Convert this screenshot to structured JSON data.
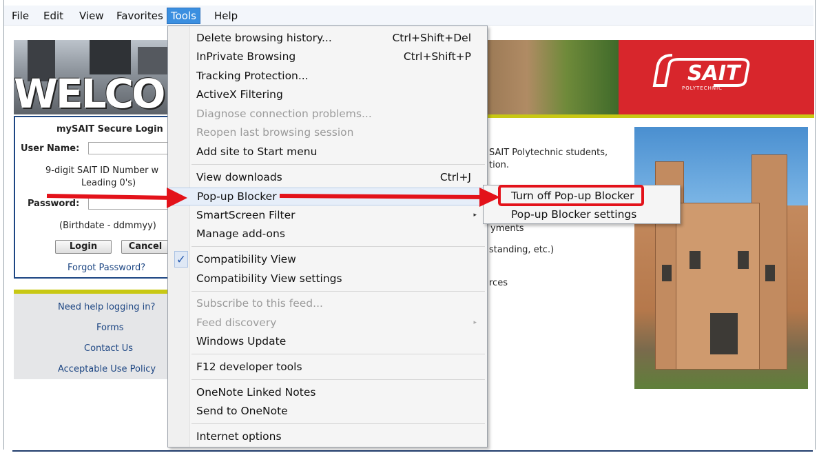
{
  "menubar": {
    "items": [
      "File",
      "Edit",
      "View",
      "Favorites",
      "Tools",
      "Help"
    ]
  },
  "banner": {
    "welcome_text": "WELCO",
    "logo_text": "SAIT",
    "logo_sub": "POLYTECHNIC",
    "accent_color": "#d8262c",
    "rule_color": "#c8c814"
  },
  "login": {
    "title": "mySAIT Secure Login",
    "username_label": "User Name:",
    "username_help_1": "9-digit SAIT ID Number w",
    "username_help_2": "Leading 0's)",
    "password_label": "Password:",
    "password_help": "(Birthdate - ddmmyy)",
    "login_button": "Login",
    "cancel_button": "Cancel",
    "forgot_link": "Forgot Password?"
  },
  "help_links": [
    "Need help logging in?",
    "Forms",
    "Contact Us",
    "Acceptable Use Policy"
  ],
  "content": {
    "line1": "SAIT Polytechnic students,",
    "line2": "tion.",
    "line3": "yments",
    "line4": "standing, etc.)",
    "line5": "rces"
  },
  "tools_menu": {
    "items": [
      {
        "label": "Delete browsing history...",
        "shortcut": "Ctrl+Shift+Del",
        "disabled": false
      },
      {
        "label": "InPrivate Browsing",
        "shortcut": "Ctrl+Shift+P",
        "disabled": false
      },
      {
        "label": "Tracking Protection...",
        "shortcut": "",
        "disabled": false
      },
      {
        "label": "ActiveX Filtering",
        "shortcut": "",
        "disabled": false
      },
      {
        "label": "Diagnose connection problems...",
        "shortcut": "",
        "disabled": true
      },
      {
        "label": "Reopen last browsing session",
        "shortcut": "",
        "disabled": true
      },
      {
        "label": "Add site to Start menu",
        "shortcut": "",
        "disabled": false
      },
      {
        "label": "View downloads",
        "shortcut": "Ctrl+J",
        "disabled": false
      },
      {
        "label": "Pop-up Blocker",
        "shortcut": "",
        "disabled": false
      },
      {
        "label": "SmartScreen Filter",
        "shortcut": "",
        "disabled": false
      },
      {
        "label": "Manage add-ons",
        "shortcut": "",
        "disabled": false
      },
      {
        "label": "Compatibility View",
        "shortcut": "",
        "disabled": false,
        "checked": true
      },
      {
        "label": "Compatibility View settings",
        "shortcut": "",
        "disabled": false
      },
      {
        "label": "Subscribe to this feed...",
        "shortcut": "",
        "disabled": true
      },
      {
        "label": "Feed discovery",
        "shortcut": "",
        "disabled": true
      },
      {
        "label": "Windows Update",
        "shortcut": "",
        "disabled": false
      },
      {
        "label": "F12 developer tools",
        "shortcut": "",
        "disabled": false
      },
      {
        "label": "OneNote Linked Notes",
        "shortcut": "",
        "disabled": false
      },
      {
        "label": "Send to OneNote",
        "shortcut": "",
        "disabled": false
      },
      {
        "label": "Internet options",
        "shortcut": "",
        "disabled": false
      }
    ]
  },
  "popup_submenu": {
    "items": [
      "Turn off Pop-up Blocker",
      "Pop-up Blocker settings"
    ]
  },
  "annotation": {
    "color": "#e3121a",
    "check_glyph": "✓",
    "arrow_glyph": "▸"
  }
}
